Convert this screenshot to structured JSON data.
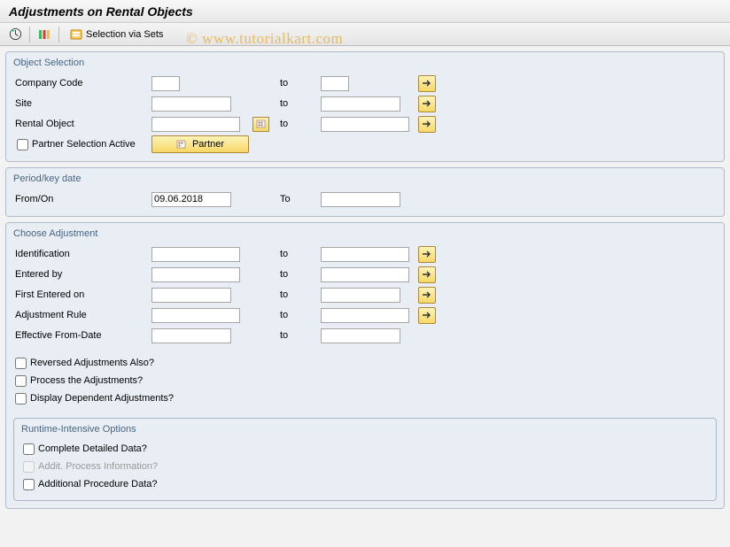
{
  "title": "Adjustments on Rental Objects",
  "watermark": "©  www.tutorialkart.com",
  "toolbar": {
    "selection_via_sets": "Selection via Sets"
  },
  "groups": {
    "object_selection": {
      "title": "Object Selection",
      "company_code": {
        "label": "Company Code",
        "from": "",
        "to_label": "to",
        "to": ""
      },
      "site": {
        "label": "Site",
        "from": "",
        "to_label": "to",
        "to": ""
      },
      "rental_object": {
        "label": "Rental Object",
        "from": "",
        "to_label": "to",
        "to": ""
      },
      "partner_active": {
        "label": "Partner Selection Active",
        "checked": false
      },
      "partner_btn": "Partner"
    },
    "period": {
      "title": "Period/key date",
      "from_on": {
        "label": "From/On",
        "value": "09.06.2018",
        "to_label": "To",
        "to": ""
      }
    },
    "choose": {
      "title": "Choose Adjustment",
      "identification": {
        "label": "Identification",
        "from": "",
        "to_label": "to",
        "to": ""
      },
      "entered_by": {
        "label": "Entered by",
        "from": "",
        "to_label": "to",
        "to": ""
      },
      "first_entered_on": {
        "label": "First Entered on",
        "from": "",
        "to_label": "to",
        "to": ""
      },
      "adjustment_rule": {
        "label": "Adjustment Rule",
        "from": "",
        "to_label": "to",
        "to": ""
      },
      "effective_from": {
        "label": "Effective From-Date",
        "from": "",
        "to_label": "to",
        "to": ""
      },
      "reversed": {
        "label": "Reversed Adjustments Also?",
        "checked": false
      },
      "process": {
        "label": "Process the Adjustments?",
        "checked": false
      },
      "display_dep": {
        "label": "Display Dependent Adjustments?",
        "checked": false
      },
      "runtime": {
        "title": "Runtime-Intensive Options",
        "complete": {
          "label": "Complete Detailed Data?",
          "checked": false
        },
        "addit": {
          "label": "Addit. Process Information?",
          "checked": false,
          "disabled": true
        },
        "additional_proc": {
          "label": "Additional Procedure Data?",
          "checked": false
        }
      }
    }
  }
}
